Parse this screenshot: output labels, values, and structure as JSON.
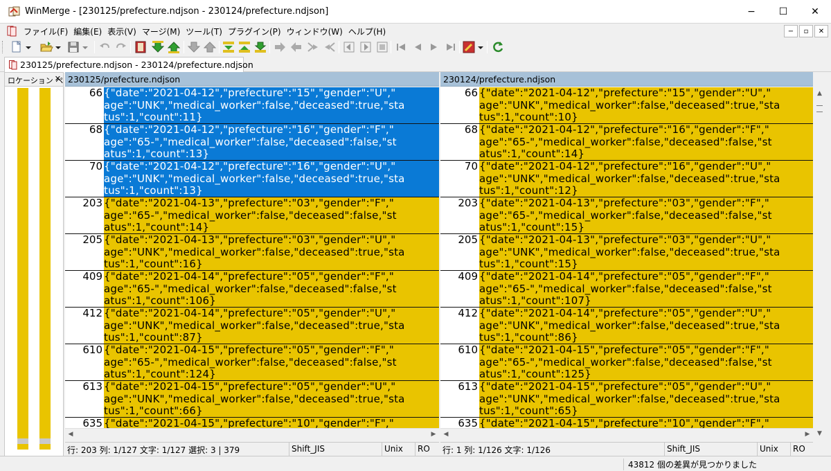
{
  "window": {
    "title": "WinMerge - [230125/prefecture.ndjson - 230124/prefecture.ndjson]",
    "minimize": "−",
    "maximize": "☐",
    "close": "✕"
  },
  "menu": {
    "items": [
      "ファイル(F)",
      "編集(E)",
      "表示(V)",
      "マージ(M)",
      "ツール(T)",
      "プラグイン(P)",
      "ウィンドウ(W)",
      "ヘルプ(H)"
    ],
    "mdi_min": "−",
    "mdi_restore": "▫",
    "mdi_close": "✕"
  },
  "tab": {
    "label": "230125/prefecture.ndjson - 230124/prefecture.ndjson"
  },
  "location_pane": {
    "header": "ロケーション ペイン",
    "close": "✕"
  },
  "left": {
    "header": "230125/prefecture.ndjson",
    "blocks": [
      {
        "lineno": "66",
        "selected": true,
        "lines": [
          "{\"date\":\"2021-04-12\",\"prefecture\":\"15\",\"gender\":\"U\",\"",
          "age\":\"UNK\",\"medical_worker\":false,\"deceased\":true,\"sta",
          "tus\":1,\"count\":11}"
        ]
      },
      {
        "lineno": "68",
        "selected": true,
        "lines": [
          "{\"date\":\"2021-04-12\",\"prefecture\":\"16\",\"gender\":\"F\",\"",
          "age\":\"65-\",\"medical_worker\":false,\"deceased\":false,\"st",
          "atus\":1,\"count\":13}"
        ]
      },
      {
        "lineno": "70",
        "selected": true,
        "lines": [
          "{\"date\":\"2021-04-12\",\"prefecture\":\"16\",\"gender\":\"U\",\"",
          "age\":\"UNK\",\"medical_worker\":false,\"deceased\":true,\"sta",
          "tus\":1,\"count\":13}"
        ]
      },
      {
        "lineno": "203",
        "selected": false,
        "lines": [
          "{\"date\":\"2021-04-13\",\"prefecture\":\"03\",\"gender\":\"F\",\"",
          "age\":\"65-\",\"medical_worker\":false,\"deceased\":false,\"st",
          "atus\":1,\"count\":14}"
        ]
      },
      {
        "lineno": "205",
        "selected": false,
        "lines": [
          "{\"date\":\"2021-04-13\",\"prefecture\":\"03\",\"gender\":\"U\",\"",
          "age\":\"UNK\",\"medical_worker\":false,\"deceased\":true,\"sta",
          "tus\":1,\"count\":16}"
        ]
      },
      {
        "lineno": "409",
        "selected": false,
        "lines": [
          "{\"date\":\"2021-04-14\",\"prefecture\":\"05\",\"gender\":\"F\",\"",
          "age\":\"65-\",\"medical_worker\":false,\"deceased\":false,\"st",
          "atus\":1,\"count\":106}"
        ]
      },
      {
        "lineno": "412",
        "selected": false,
        "lines": [
          "{\"date\":\"2021-04-14\",\"prefecture\":\"05\",\"gender\":\"U\",\"",
          "age\":\"UNK\",\"medical_worker\":false,\"deceased\":true,\"sta",
          "tus\":1,\"count\":87}"
        ]
      },
      {
        "lineno": "610",
        "selected": false,
        "lines": [
          "{\"date\":\"2021-04-15\",\"prefecture\":\"05\",\"gender\":\"F\",\"",
          "age\":\"65-\",\"medical_worker\":false,\"deceased\":false,\"st",
          "atus\":1,\"count\":124}"
        ]
      },
      {
        "lineno": "613",
        "selected": false,
        "lines": [
          "{\"date\":\"2021-04-15\",\"prefecture\":\"05\",\"gender\":\"U\",\"",
          "age\":\"UNK\",\"medical_worker\":false,\"deceased\":true,\"sta",
          "tus\":1,\"count\":66}"
        ]
      },
      {
        "lineno": "635",
        "selected": false,
        "lines": [
          "{\"date\":\"2021-04-15\",\"prefecture\":\"10\",\"gender\":\"F\",\"",
          "",
          ""
        ]
      }
    ],
    "status": {
      "pos": "行: 203  列: 1/127  文字: 1/127  選択: 3 | 379",
      "encoding": "Shift_JIS",
      "eol": "Unix",
      "ro": "RO"
    }
  },
  "right": {
    "header": "230124/prefecture.ndjson",
    "blocks": [
      {
        "lineno": "66",
        "lines": [
          "{\"date\":\"2021-04-12\",\"prefecture\":\"15\",\"gender\":\"U\",\"",
          "age\":\"UNK\",\"medical_worker\":false,\"deceased\":true,\"sta",
          "tus\":1,\"count\":10}"
        ]
      },
      {
        "lineno": "68",
        "lines": [
          "{\"date\":\"2021-04-12\",\"prefecture\":\"16\",\"gender\":\"F\",\"",
          "age\":\"65-\",\"medical_worker\":false,\"deceased\":false,\"st",
          "atus\":1,\"count\":14}"
        ]
      },
      {
        "lineno": "70",
        "lines": [
          "{\"date\":\"2021-04-12\",\"prefecture\":\"16\",\"gender\":\"U\",\"",
          "age\":\"UNK\",\"medical_worker\":false,\"deceased\":true,\"sta",
          "tus\":1,\"count\":12}"
        ]
      },
      {
        "lineno": "203",
        "lines": [
          "{\"date\":\"2021-04-13\",\"prefecture\":\"03\",\"gender\":\"F\",\"",
          "age\":\"65-\",\"medical_worker\":false,\"deceased\":false,\"st",
          "atus\":1,\"count\":15}"
        ]
      },
      {
        "lineno": "205",
        "lines": [
          "{\"date\":\"2021-04-13\",\"prefecture\":\"03\",\"gender\":\"U\",\"",
          "age\":\"UNK\",\"medical_worker\":false,\"deceased\":true,\"sta",
          "tus\":1,\"count\":15}"
        ]
      },
      {
        "lineno": "409",
        "lines": [
          "{\"date\":\"2021-04-14\",\"prefecture\":\"05\",\"gender\":\"F\",\"",
          "age\":\"65-\",\"medical_worker\":false,\"deceased\":false,\"st",
          "atus\":1,\"count\":107}"
        ]
      },
      {
        "lineno": "412",
        "lines": [
          "{\"date\":\"2021-04-14\",\"prefecture\":\"05\",\"gender\":\"U\",\"",
          "age\":\"UNK\",\"medical_worker\":false,\"deceased\":true,\"sta",
          "tus\":1,\"count\":86}"
        ]
      },
      {
        "lineno": "610",
        "lines": [
          "{\"date\":\"2021-04-15\",\"prefecture\":\"05\",\"gender\":\"F\",\"",
          "age\":\"65-\",\"medical_worker\":false,\"deceased\":false,\"st",
          "atus\":1,\"count\":125}"
        ]
      },
      {
        "lineno": "613",
        "lines": [
          "{\"date\":\"2021-04-15\",\"prefecture\":\"05\",\"gender\":\"U\",\"",
          "age\":\"UNK\",\"medical_worker\":false,\"deceased\":true,\"sta",
          "tus\":1,\"count\":65}"
        ]
      },
      {
        "lineno": "635",
        "lines": [
          "{\"date\":\"2021-04-15\",\"prefecture\":\"10\",\"gender\":\"F\",\"",
          "",
          ""
        ]
      }
    ],
    "status": {
      "pos": "行: 1  列: 1/126  文字: 1/126",
      "encoding": "Shift_JIS",
      "eol": "Unix",
      "ro": "RO"
    }
  },
  "statusbar": {
    "message": "43812 個の差異が見つかりました"
  },
  "colors": {
    "diff": "#e9c400",
    "selected": "#0a7ad6",
    "header": "#a7c1d8"
  },
  "icons": {
    "app": "winmerge-icon",
    "toolbar": [
      "new-icon",
      "open-icon",
      "save-icon",
      "undo-icon",
      "redo-icon",
      "film-icon",
      "next-diff-down-icon",
      "prev-diff-up-icon",
      "first-diff-icon",
      "last-diff-icon",
      "copy-left-icon",
      "copy-right-icon",
      "copy-all-icon",
      "arrow-right-icon",
      "arrow-left-icon",
      "merge-right-icon",
      "merge-left-icon",
      "pane-left-icon",
      "pane-right-icon",
      "pane-both-icon",
      "nav-first-icon",
      "nav-prev-icon",
      "nav-next-icon",
      "nav-last-icon",
      "options-icon",
      "refresh-icon"
    ]
  }
}
